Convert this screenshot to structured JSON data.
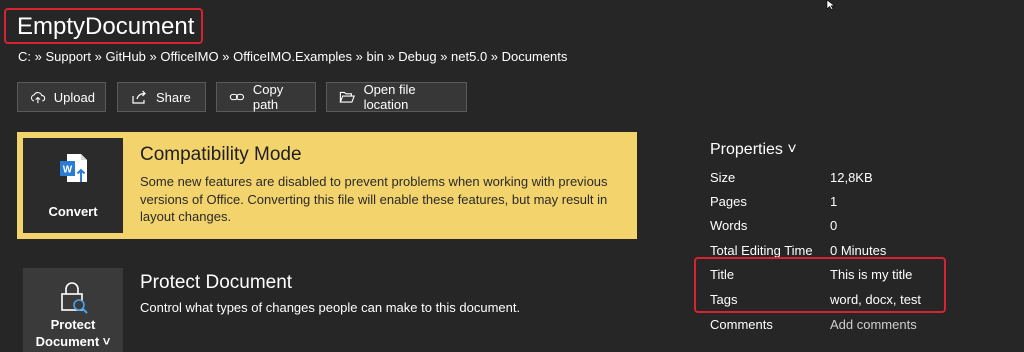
{
  "document": {
    "title": "EmptyDocument"
  },
  "breadcrumb": "C: » Support » GitHub » OfficeIMO » OfficeIMO.Examples » bin » Debug » net5.0 » Documents",
  "toolbar": {
    "upload": "Upload",
    "share": "Share",
    "copy_path": "Copy path",
    "open_location": "Open file location"
  },
  "compatibility": {
    "button_label": "Convert",
    "title": "Compatibility Mode",
    "description": "Some new features are disabled to prevent problems when working with previous versions of Office. Converting this file will enable these features, but may result in layout changes."
  },
  "protect": {
    "button_label_line1": "Protect",
    "button_label_line2": "Document ˅",
    "title": "Protect Document",
    "description": "Control what types of changes people can make to this document."
  },
  "properties": {
    "heading": "Properties ˅",
    "items": [
      {
        "label": "Size",
        "value": "12,8KB"
      },
      {
        "label": "Pages",
        "value": "1"
      },
      {
        "label": "Words",
        "value": "0"
      },
      {
        "label": "Total Editing Time",
        "value": "0 Minutes"
      },
      {
        "label": "Title",
        "value": "This is my title"
      },
      {
        "label": "Tags",
        "value": "word, docx, test"
      },
      {
        "label": "Comments",
        "value": "Add comments"
      }
    ]
  },
  "colors": {
    "background": "#262626",
    "compat_panel": "#f3d36c",
    "highlight_border": "#d7232f",
    "word_blue": "#2b7cd3"
  }
}
